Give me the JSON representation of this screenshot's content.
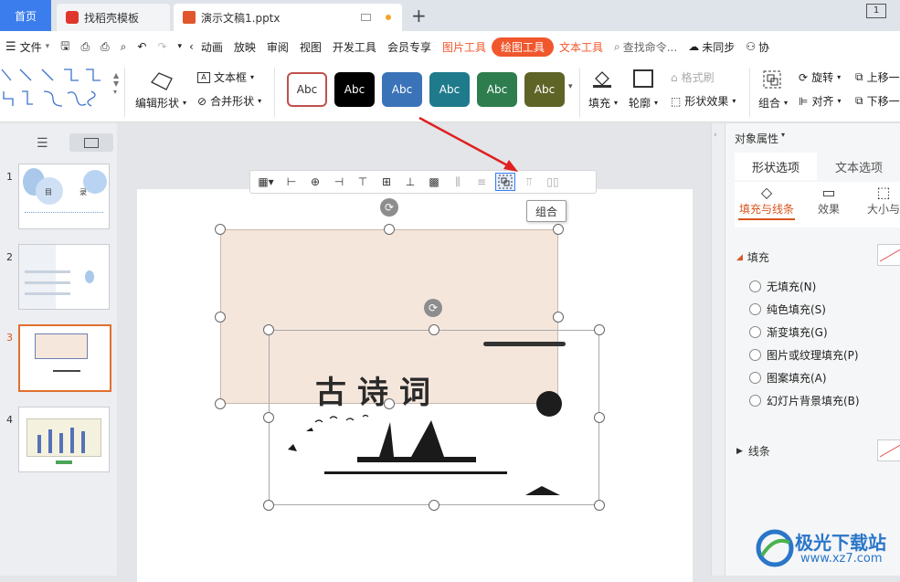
{
  "tabs": {
    "home": "首页",
    "template": "找稻壳模板",
    "doc": "演示文稿1.pptx",
    "new_tab": "+"
  },
  "window_badge": "1",
  "menu": {
    "file": "文件",
    "animation": "动画",
    "slideshow": "放映",
    "review": "审阅",
    "view": "视图",
    "developer": "开发工具",
    "member": "会员专享",
    "picture_tools": "图片工具",
    "drawing_tools": "绘图工具",
    "text_tools": "文本工具",
    "search": "查找命令...",
    "unsynced": "未同步",
    "collab": "协"
  },
  "ribbon": {
    "edit_shape": "编辑形状",
    "textbox": "文本框",
    "merge_shape": "合并形状",
    "style_label": "Abc",
    "fill": "填充",
    "outline": "轮廓",
    "format_painter": "格式刷",
    "shape_effect": "形状效果",
    "group": "组合",
    "rotate": "旋转",
    "align": "对齐",
    "bring_forward": "上移一",
    "send_backward": "下移一"
  },
  "style_colors": [
    "#ffffff",
    "#000000",
    "#3a73b8",
    "#1f7b8c",
    "#2e7d4f",
    "#5e6426"
  ],
  "slides": [
    {
      "num": "1",
      "title_a": "目",
      "title_b": "录"
    },
    {
      "num": "2"
    },
    {
      "num": "3"
    },
    {
      "num": "4"
    }
  ],
  "slide_text": {
    "calligraphy": "古诗词"
  },
  "tooltip": "组合",
  "panel": {
    "header": "对象属性",
    "tab_shape": "形状选项",
    "tab_text": "文本选项",
    "sub_fill_line": "填充与线条",
    "sub_effect": "效果",
    "sub_size": "大小与",
    "fill_section": "填充",
    "options": [
      "无填充(N)",
      "纯色填充(S)",
      "渐变填充(G)",
      "图片或纹理填充(P)",
      "图案填充(A)",
      "幻灯片背景填充(B)"
    ],
    "line_section": "线条"
  },
  "watermark": {
    "title": "极光下载站",
    "url": "www.xz7.com"
  }
}
